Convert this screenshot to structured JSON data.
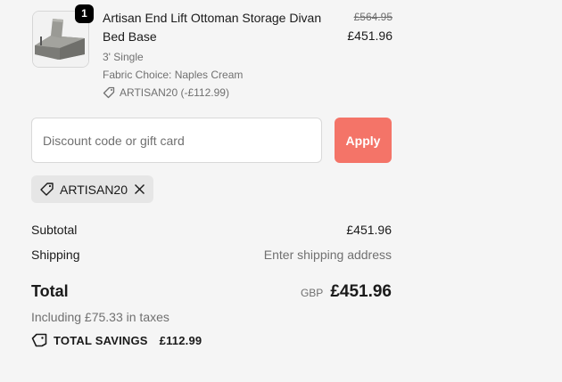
{
  "product": {
    "quantity": "1",
    "name": "Artisan End Lift Ottoman Storage Divan Bed Base",
    "size": "3' Single",
    "fabric": "Fabric Choice: Naples Cream",
    "discount_tag": "ARTISAN20 (-£112.99)",
    "price_original": "£564.95",
    "price_current": "£451.96",
    "thumbnail_icon": "bed-thumbnail"
  },
  "discount": {
    "placeholder": "Discount code or gift card",
    "value": "",
    "apply_label": "Apply"
  },
  "applied_code": {
    "code": "ARTISAN20",
    "tag_icon": "tag-icon",
    "remove_icon": "close-icon"
  },
  "summary": {
    "subtotal_label": "Subtotal",
    "subtotal_value": "£451.96",
    "shipping_label": "Shipping",
    "shipping_value": "Enter shipping address",
    "total_label": "Total",
    "currency": "GBP",
    "total_value": "£451.96",
    "taxes_text": "Including £75.33 in taxes",
    "savings_label": "TOTAL SAVINGS",
    "savings_value": "£112.99"
  },
  "colors": {
    "accent": "#f47468",
    "background": "#f5f5f5",
    "chip": "#e6e6e6",
    "muted_text": "#707070"
  }
}
